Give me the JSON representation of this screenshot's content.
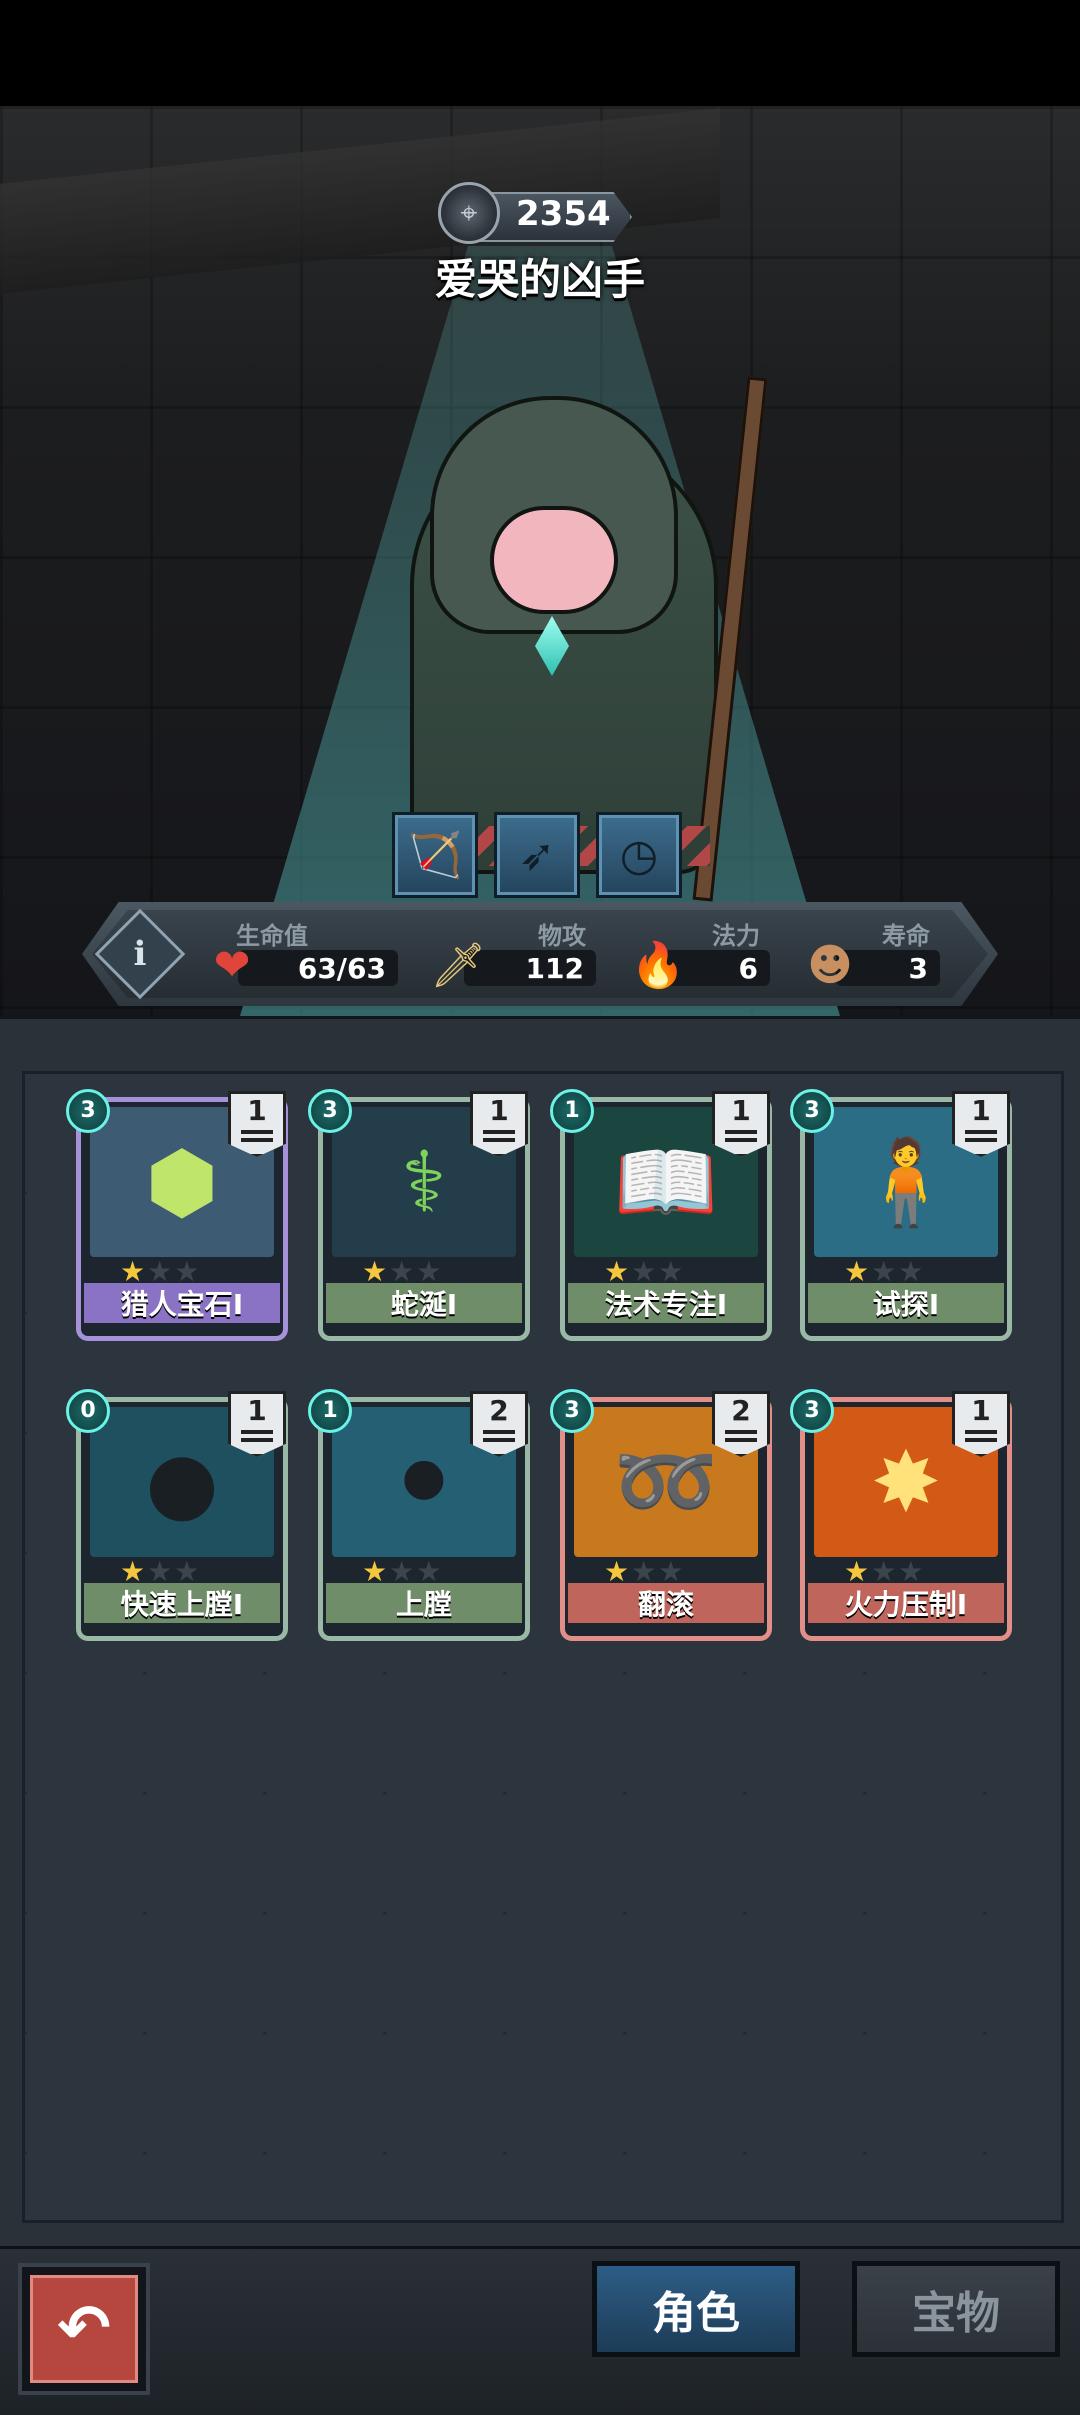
{
  "enemy": {
    "score": "2354",
    "name": "爱哭的凶手",
    "skill_icons": [
      "archery-icon",
      "bow-icon",
      "clock-icon"
    ]
  },
  "stats": {
    "hp": {
      "label": "生命值",
      "value": "63/63",
      "icon": "heart-icon"
    },
    "attack": {
      "label": "物攻",
      "value": "112",
      "icon": "sword-icon"
    },
    "mana": {
      "label": "法力",
      "value": "6",
      "icon": "flame-icon"
    },
    "lifespan": {
      "label": "寿命",
      "value": "3",
      "icon": "portrait-icon"
    }
  },
  "cards": [
    {
      "name": "猎人宝石I",
      "cost": "3",
      "level": "1",
      "stars": 1,
      "rarity": "purple",
      "art": "gem-icon",
      "art_color": "#3e5b74"
    },
    {
      "name": "蛇涎I",
      "cost": "3",
      "level": "1",
      "stars": 1,
      "rarity": "green",
      "art": "snake-staff-icon",
      "art_color": "#233d4a"
    },
    {
      "name": "法术专注I",
      "cost": "1",
      "level": "1",
      "stars": 1,
      "rarity": "green",
      "art": "spellbook-icon",
      "art_color": "#1b4640"
    },
    {
      "name": "试探I",
      "cost": "3",
      "level": "1",
      "stars": 1,
      "rarity": "green",
      "art": "gunner-icon",
      "art_color": "#2c6d86"
    },
    {
      "name": "快速上膛I",
      "cost": "0",
      "level": "1",
      "stars": 1,
      "rarity": "green",
      "art": "bullet-icon",
      "art_color": "#1f5060"
    },
    {
      "name": "上膛",
      "cost": "1",
      "level": "2",
      "stars": 1,
      "rarity": "green",
      "art": "bullets-icon",
      "art_color": "#245f73"
    },
    {
      "name": "翻滚",
      "cost": "3",
      "level": "2",
      "stars": 1,
      "rarity": "red",
      "art": "roll-icon",
      "art_color": "#c8791e"
    },
    {
      "name": "火力压制I",
      "cost": "3",
      "level": "1",
      "stars": 1,
      "rarity": "red",
      "art": "fire-burst-icon",
      "art_color": "#d35a16"
    }
  ],
  "bottom": {
    "back_icon": "back-arrow-icon",
    "tabs": [
      {
        "label": "角色",
        "active": true
      },
      {
        "label": "宝物",
        "active": false
      }
    ]
  }
}
